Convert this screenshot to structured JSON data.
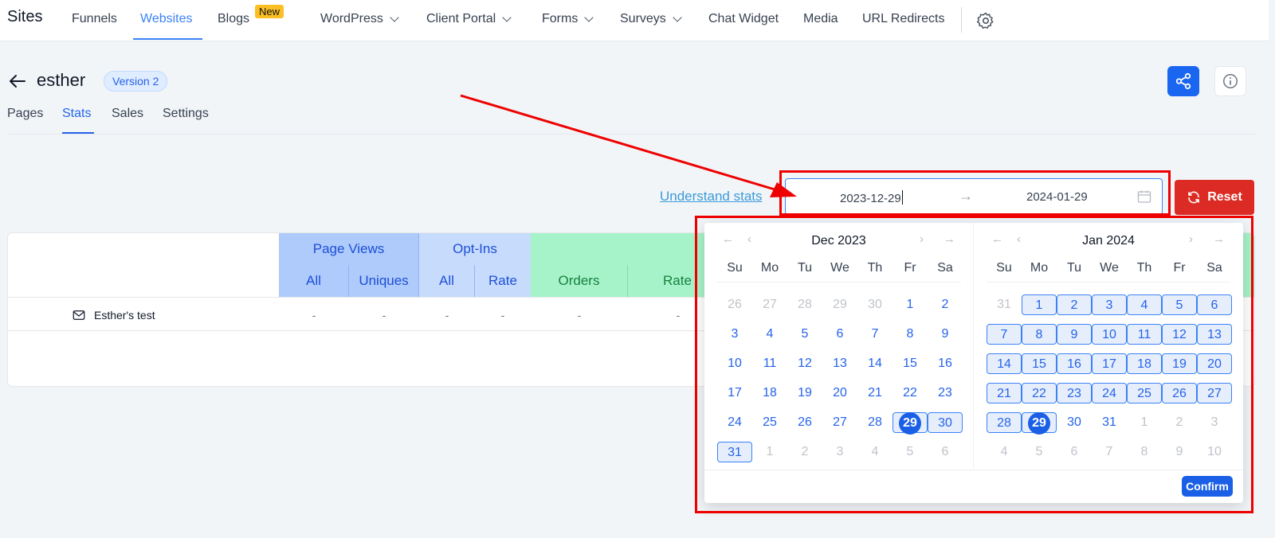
{
  "nav": {
    "brand": "Sites",
    "items": [
      {
        "label": "Funnels"
      },
      {
        "label": "Websites"
      },
      {
        "label": "Blogs",
        "badge": "New"
      },
      {
        "label": "WordPress"
      },
      {
        "label": "Client Portal"
      },
      {
        "label": "Forms"
      },
      {
        "label": "Surveys"
      },
      {
        "label": "Chat Widget"
      },
      {
        "label": "Media"
      },
      {
        "label": "URL Redirects"
      }
    ],
    "settings_icon": "gear-icon"
  },
  "header": {
    "site_name": "esther",
    "version": "Version 2",
    "share_icon": "share-icon",
    "info_icon": "info-icon"
  },
  "tabs": [
    "Pages",
    "Stats",
    "Sales",
    "Settings"
  ],
  "stats": {
    "understand_link": "Understand stats",
    "start_date": "2023-12-29",
    "end_date": "2024-01-29",
    "range_arrow": "→",
    "reset_label": "Reset"
  },
  "table": {
    "groups": [
      "Page Views",
      "Opt-Ins"
    ],
    "columns": [
      "All",
      "Uniques",
      "All",
      "Rate",
      "Orders",
      "Rate"
    ],
    "rows": [
      {
        "name": "Esther's test",
        "values": [
          "-",
          "-",
          "-",
          "-",
          "-",
          "-"
        ]
      }
    ]
  },
  "picker": {
    "weekdays": [
      "Su",
      "Mo",
      "Tu",
      "We",
      "Th",
      "Fr",
      "Sa"
    ],
    "left_title": "Dec 2023",
    "right_title": "Jan 2024",
    "left_days": [
      "26",
      "27",
      "28",
      "29",
      "30",
      "1",
      "2",
      "3",
      "4",
      "5",
      "6",
      "7",
      "8",
      "9",
      "10",
      "11",
      "12",
      "13",
      "14",
      "15",
      "16",
      "17",
      "18",
      "19",
      "20",
      "21",
      "22",
      "23",
      "24",
      "25",
      "26",
      "27",
      "28",
      "29",
      "30",
      "31",
      "1",
      "2",
      "3",
      "4",
      "5",
      "6"
    ],
    "right_days": [
      "31",
      "1",
      "2",
      "3",
      "4",
      "5",
      "6",
      "7",
      "8",
      "9",
      "10",
      "11",
      "12",
      "13",
      "14",
      "15",
      "16",
      "17",
      "18",
      "19",
      "20",
      "21",
      "22",
      "23",
      "24",
      "25",
      "26",
      "27",
      "28",
      "29",
      "30",
      "31",
      "1",
      "2",
      "3",
      "4",
      "5",
      "6",
      "7",
      "8",
      "9",
      "10"
    ],
    "confirm_label": "Confirm",
    "nav_prev_year": "←",
    "nav_prev_month": "‹",
    "nav_next_month": "›",
    "nav_next_year": "→"
  },
  "colors": {
    "accent": "#1a5fe6",
    "reset": "#dc2b24",
    "annotation": "#ef0000"
  }
}
